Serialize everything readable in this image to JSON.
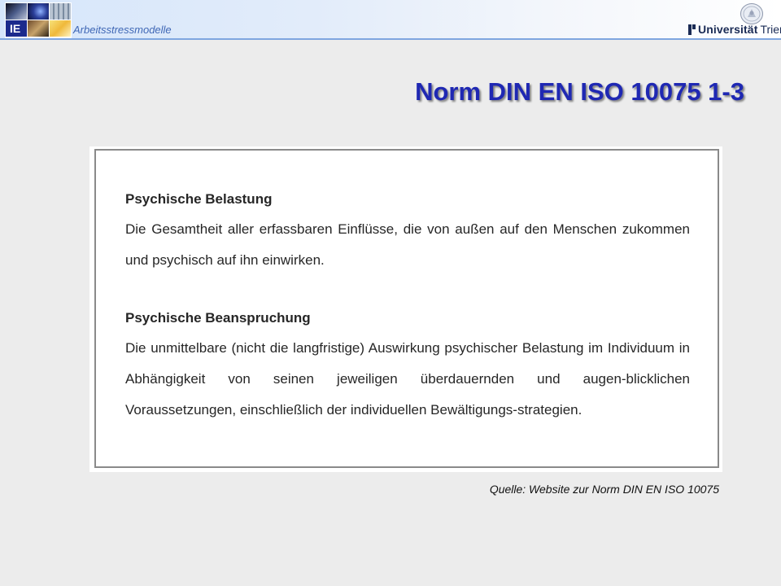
{
  "header": {
    "section_label": "Arbeitsstressmodelle",
    "university": {
      "name": "Universität",
      "city": "Trier"
    },
    "icons": [
      "header-photo-collage-icon",
      "university-seal-icon",
      "university-logo-mark-icon"
    ]
  },
  "slide": {
    "title": "Norm DIN EN ISO 10075 1-3",
    "definitions": [
      {
        "term": "Psychische Belastung",
        "text": "Die Gesamtheit aller erfassbaren Einflüsse, die von außen auf den Menschen zukommen und psychisch auf ihn einwirken."
      },
      {
        "term": "Psychische Beanspruchung",
        "text": "Die unmittelbare (nicht die langfristige) Auswirkung psychischer Belastung im Individuum in Abhängigkeit von seinen jeweiligen überdauernden und augen-blicklichen Voraussetzungen, einschließlich der individuellen Bewältigungs-strategien."
      }
    ],
    "source": "Quelle: Website zur Norm DIN EN ISO 10075"
  },
  "colors": {
    "title": "#1f28b3",
    "section_label": "#3f67b5",
    "header_line": "#7fa6e0",
    "background": "#ececec"
  }
}
